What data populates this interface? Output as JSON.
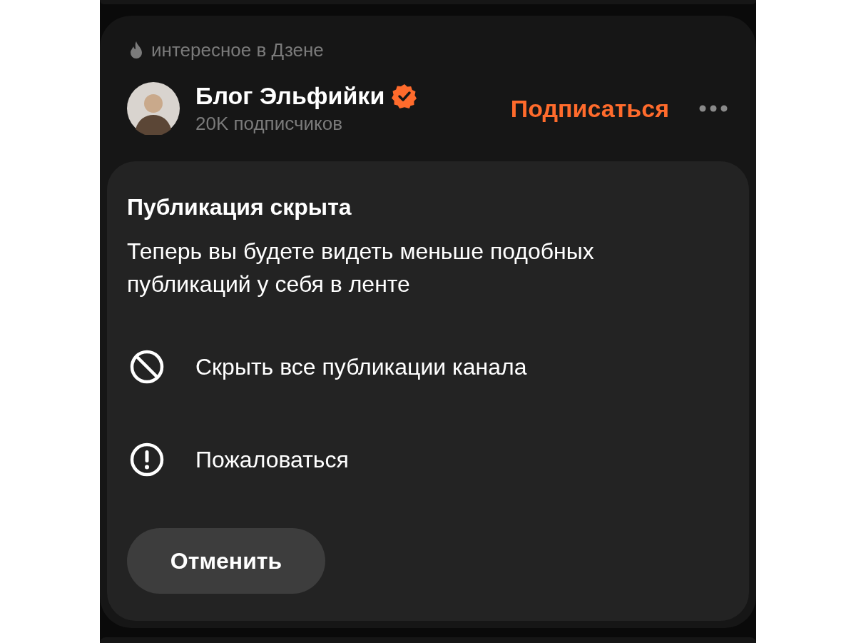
{
  "feed_label": "интересное в Дзене",
  "channel": {
    "name": "Блог Эльфийки",
    "verified": true,
    "subscribers": "20K подписчиков",
    "subscribe_button": "Подписаться"
  },
  "hidden_notice": {
    "title": "Публикация скрыта",
    "message": "Теперь вы будете видеть меньше подобных публикаций у себя в ленте",
    "actions": [
      {
        "kind": "block",
        "label": "Скрыть все публикации канала"
      },
      {
        "kind": "report",
        "label": "Пожаловаться"
      }
    ],
    "cancel_button": "Отменить"
  }
}
